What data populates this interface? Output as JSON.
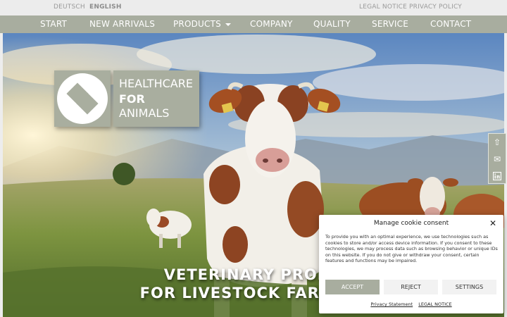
{
  "topbar": {
    "languages": [
      "DEUTSCH",
      "ENGLISH"
    ],
    "active_language": "ENGLISH",
    "legal_notice": "LEGAL NOTICE",
    "privacy_policy": "PRIVACY POLICY"
  },
  "nav": {
    "items": [
      "START",
      "NEW ARRIVALS",
      "PRODUCTS",
      "COMPANY",
      "QUALITY",
      "SERVICE",
      "CONTACT"
    ]
  },
  "logo": {
    "line1": "HEALTHCARE",
    "line2": "FOR",
    "line3": "ANIMALS"
  },
  "hero": {
    "headline_line1": "VETERINARY PRODU",
    "headline_line2": "FOR LIVESTOCK FARMING"
  },
  "social": {
    "icons": [
      "arrow-up-icon",
      "mail-icon",
      "linkedin-icon"
    ]
  },
  "cookie": {
    "title": "Manage cookie consent",
    "text": "To provide you with an optimal experience, we use technologies such as cookies to store and/or access device information. If you consent to these technologies, we may process data such as browsing behavior or unique IDs on this website. If you do not give or withdraw your consent, certain features and functions may be impaired.",
    "accept": "ACCEPT",
    "reject": "REJECT",
    "settings": "SETTINGS",
    "privacy_statement": "Privacy Statement",
    "legal_notice": "LEGAL NOTICE"
  },
  "colors": {
    "brand": "#a8ad9f",
    "sky_top": "#5b86c0",
    "grass": "#6f8a3a"
  }
}
